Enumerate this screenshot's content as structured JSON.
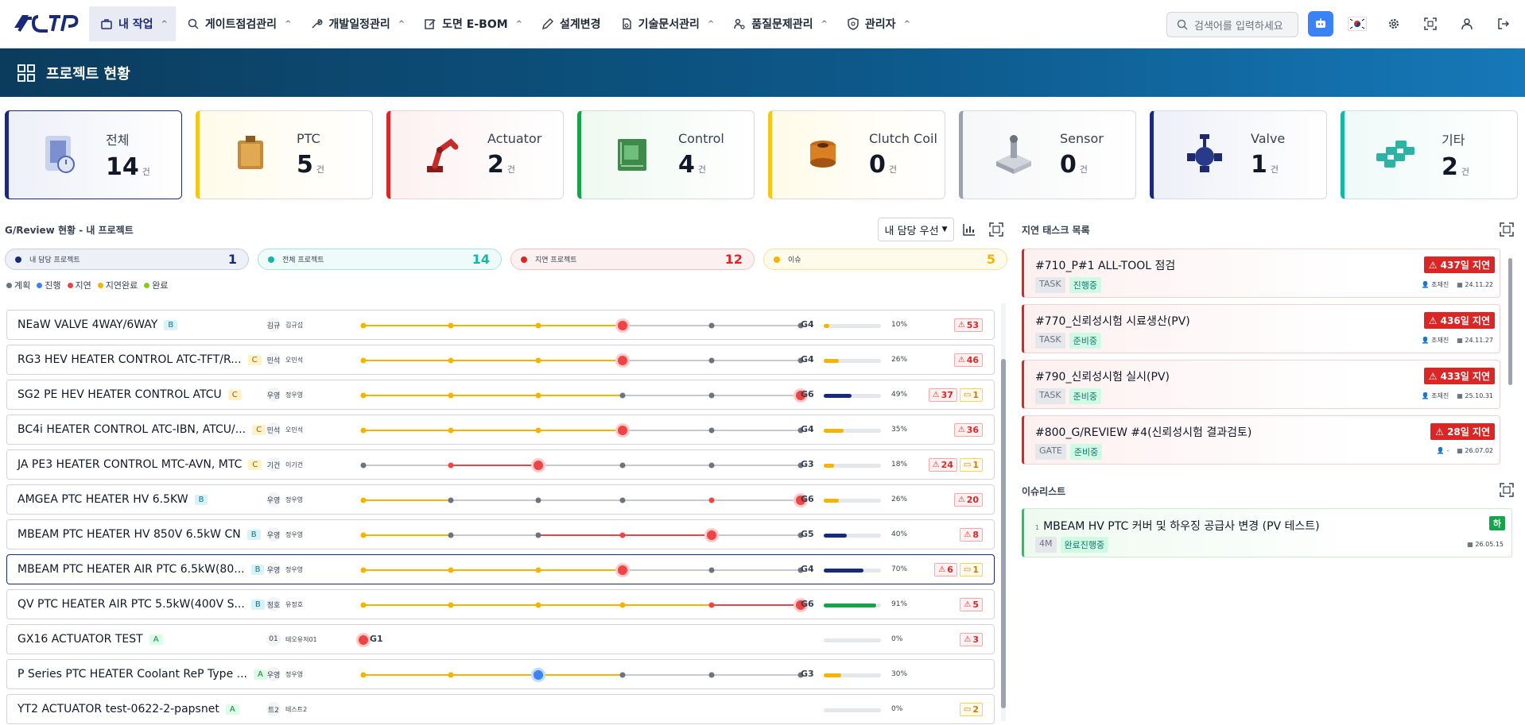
{
  "nav": {
    "items": [
      {
        "label": "내 작업",
        "icon": "briefcase-icon",
        "active": true
      },
      {
        "label": "게이트점검관리",
        "icon": "search-icon"
      },
      {
        "label": "개발일정관리",
        "icon": "wrench-icon"
      },
      {
        "label": "도면 E-BOM",
        "icon": "edit-icon"
      },
      {
        "label": "설계변경",
        "icon": "pencil-icon"
      },
      {
        "label": "기술문서관리",
        "icon": "document-icon"
      },
      {
        "label": "품질문제관리",
        "icon": "quality-icon"
      },
      {
        "label": "관리자",
        "icon": "shield-icon"
      }
    ],
    "search_placeholder": "검색어를 입력하세요"
  },
  "banner": {
    "title": "프로젝트 현황"
  },
  "cards": [
    {
      "label": "전체",
      "count": "14",
      "unit": "건",
      "color": "#1a2a7a",
      "bg": "#eef0f8"
    },
    {
      "label": "PTC",
      "count": "5",
      "unit": "건",
      "color": "#f5c518",
      "bg": "#fffbea"
    },
    {
      "label": "Actuator",
      "count": "2",
      "unit": "건",
      "color": "#dc2626",
      "bg": "#fdf1f1"
    },
    {
      "label": "Control",
      "count": "4",
      "unit": "건",
      "color": "#16a34a",
      "bg": "#eff9f1"
    },
    {
      "label": "Clutch Coil",
      "count": "0",
      "unit": "건",
      "color": "#f5c518",
      "bg": "#fffbea"
    },
    {
      "label": "Sensor",
      "count": "0",
      "unit": "건",
      "color": "#9ca3af",
      "bg": "#f6f7f8"
    },
    {
      "label": "Valve",
      "count": "1",
      "unit": "건",
      "color": "#1a2a7a",
      "bg": "#eef0f8"
    },
    {
      "label": "기타",
      "count": "2",
      "unit": "건",
      "color": "#14b8a6",
      "bg": "#effaf8"
    }
  ],
  "review": {
    "title": "G/Review 현황 - 내 프로젝트",
    "sort_label": "내 담당 우선",
    "stats": [
      {
        "label": "내 담당 프로젝트",
        "value": "1",
        "color": "#1a2a7a",
        "bg": "#eef0f8",
        "border": "#c7cce4"
      },
      {
        "label": "전체 프로젝트",
        "value": "14",
        "color": "#14b8a6",
        "bg": "#eefbf9",
        "border": "#a7e5dc"
      },
      {
        "label": "지연 프로젝트",
        "value": "12",
        "color": "#dc2626",
        "bg": "#fdf0f0",
        "border": "#f5c2c2"
      },
      {
        "label": "이슈",
        "value": "5",
        "color": "#f5b400",
        "bg": "#fffbea",
        "border": "#f5e09a"
      }
    ],
    "legend": [
      {
        "label": "계획",
        "color": "#6b7280"
      },
      {
        "label": "진행",
        "color": "#3b82f6"
      },
      {
        "label": "지연",
        "color": "#ef4444"
      },
      {
        "label": "지연완료",
        "color": "#f5b400"
      },
      {
        "label": "완료",
        "color": "#84cc16"
      }
    ],
    "rows": [
      {
        "name": "NEaW VALVE 4WAY/6WAY",
        "grade": "B",
        "owner_short": "김규",
        "owner": "김규섭",
        "gate": "G4",
        "pct": "10%",
        "progress": 0.1,
        "bar": "#f5b400",
        "delay": "53",
        "issue": ""
      },
      {
        "name": "RG3 HEV HEATER CONTROL ATC-TFT/R...",
        "grade": "C",
        "owner_short": "민석",
        "owner": "오민석",
        "gate": "G4",
        "pct": "26%",
        "progress": 0.26,
        "bar": "#f5b400",
        "delay": "46",
        "issue": ""
      },
      {
        "name": "SG2 PE HEV HEATER CONTROL ATCU",
        "grade": "C",
        "owner_short": "우영",
        "owner": "정우영",
        "gate": "G6",
        "pct": "49%",
        "progress": 0.49,
        "bar": "#1a2a7a",
        "delay": "37",
        "issue": "1"
      },
      {
        "name": "BC4i HEATER CONTROL ATC-IBN, ATCU/...",
        "grade": "C",
        "owner_short": "민석",
        "owner": "오민석",
        "gate": "G4",
        "pct": "35%",
        "progress": 0.35,
        "bar": "#f5b400",
        "delay": "36",
        "issue": ""
      },
      {
        "name": "JA PE3 HEATER CONTROL MTC-AVN, MTC",
        "grade": "C",
        "owner_short": "기건",
        "owner": "이기건",
        "gate": "G3",
        "pct": "18%",
        "progress": 0.18,
        "bar": "#f5b400",
        "delay": "24",
        "issue": "1"
      },
      {
        "name": "AMGEA PTC HEATER HV 6.5KW",
        "grade": "B",
        "owner_short": "우영",
        "owner": "정우영",
        "gate": "G6",
        "pct": "26%",
        "progress": 0.26,
        "bar": "#f5b400",
        "delay": "20",
        "issue": ""
      },
      {
        "name": "MBEAM PTC HEATER HV 850V 6.5kW CN",
        "grade": "B",
        "owner_short": "우영",
        "owner": "정우영",
        "gate": "G5",
        "pct": "40%",
        "progress": 0.4,
        "bar": "#1a2a7a",
        "delay": "8",
        "issue": ""
      },
      {
        "name": "MBEAM PTC HEATER AIR PTC 6.5kW(80...",
        "grade": "B",
        "owner_short": "우영",
        "owner": "정우영",
        "gate": "G4",
        "pct": "70%",
        "progress": 0.7,
        "bar": "#1a2a7a",
        "delay": "6",
        "issue": "1"
      },
      {
        "name": "QV PTC HEATER AIR PTC 5.5kW(400V S...",
        "grade": "B",
        "owner_short": "정호",
        "owner": "유정호",
        "gate": "G6",
        "pct": "91%",
        "progress": 0.91,
        "bar": "#16a34a",
        "delay": "5",
        "issue": ""
      },
      {
        "name": "GX16 ACTUATOR TEST",
        "grade": "A",
        "owner_short": "01",
        "owner": "테오유저01",
        "gate": "G1",
        "pct": "0%",
        "progress": 0,
        "bar": "#f5b400",
        "delay": "3",
        "issue": ""
      },
      {
        "name": "P Series PTC HEATER Coolant ReP Type ...",
        "grade": "A",
        "owner_short": "우영",
        "owner": "정우영",
        "gate": "G3",
        "pct": "30%",
        "progress": 0.3,
        "bar": "#f5b400",
        "delay": "",
        "issue": ""
      },
      {
        "name": "YT2 ACTUATOR test-0622-2-papsnet",
        "grade": "A",
        "owner_short": "트2",
        "owner": "테스트2",
        "gate": "",
        "pct": "0%",
        "progress": 0,
        "bar": "#f5b400",
        "delay": "",
        "issue": "2"
      }
    ]
  },
  "delayed": {
    "title": "지연 태스크 목록",
    "tasks": [
      {
        "title": "#710_P#1 ALL-TOOL 점검",
        "delay": "437일 지연",
        "type": "TASK",
        "status": "진행중",
        "owner": "조재진",
        "date": "24.11.22"
      },
      {
        "title": "#770_신뢰성시험 시료생산(PV)",
        "delay": "436일 지연",
        "type": "TASK",
        "status": "준비중",
        "owner": "조재진",
        "date": "24.11.27"
      },
      {
        "title": "#790_신뢰성시험 실시(PV)",
        "delay": "433일 지연",
        "type": "TASK",
        "status": "준비중",
        "owner": "조재진",
        "date": "25.10.31"
      },
      {
        "title": "#800_G/REVIEW #4(신뢰성시험 결과검토)",
        "delay": "28일 지연",
        "type": "GATE",
        "status": "준비중",
        "owner": "-",
        "date": "26.07.02"
      }
    ]
  },
  "issues": {
    "title": "이슈리스트",
    "items": [
      {
        "num": "1",
        "title": "MBEAM HV PTC 커버 및 하우징 공급사 변경 (PV 테스트)",
        "level": "하",
        "tag1": "4M",
        "tag2": "완료진행중",
        "date": "26.05.15"
      }
    ]
  }
}
